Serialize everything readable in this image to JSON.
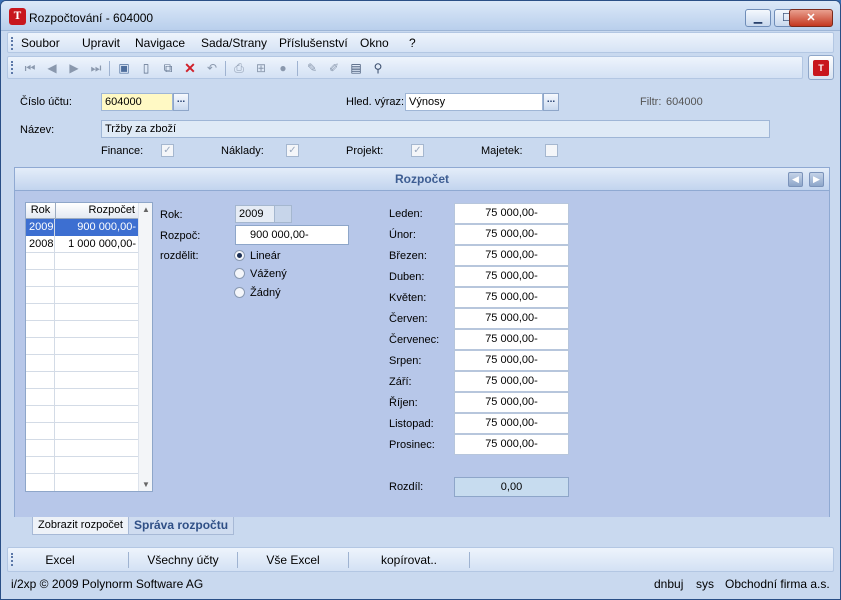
{
  "window": {
    "title": "Rozpočtování - 604000",
    "icon": "app-logo-icon",
    "minimize": "▁",
    "maximize": "☐",
    "close": "✕"
  },
  "menu": {
    "items": [
      "Soubor",
      "Upravit",
      "Navigace",
      "Sada/Strany",
      "Příslušenství",
      "Okno",
      "?"
    ]
  },
  "toolbar": {
    "icons": [
      "first-record-icon",
      "prev-record-icon",
      "next-record-icon",
      "last-record-icon",
      "save-icon",
      "new-document-icon",
      "copy-icon",
      "delete-icon",
      "undo-icon",
      "print-icon",
      "tree-icon",
      "refresh-icon",
      "edit-icon",
      "highlight-icon",
      "filter-icon",
      "wizard-icon"
    ]
  },
  "header": {
    "account_label": "Číslo účtu:",
    "account_value": "604000",
    "search_label": "Hled. výraz:",
    "search_value": "Výnosy",
    "filter_label": "Filtr:",
    "filter_value": "604000",
    "name_label": "Název:",
    "name_value": "Tržby za zboží",
    "dots": "...",
    "checkboxes": [
      {
        "label": "Finance:",
        "checked": true
      },
      {
        "label": "Náklady:",
        "checked": true
      },
      {
        "label": "Projekt:",
        "checked": true
      },
      {
        "label": "Majetek:",
        "checked": false
      }
    ],
    "check_mark": "✓"
  },
  "panel": {
    "title": "Rozpočet",
    "grid_headers": [
      "Rok",
      "Rozpočet"
    ],
    "grid_rows": [
      {
        "year": "2009",
        "budget": "900 000,00-",
        "selected": true
      },
      {
        "year": "2008",
        "budget": "1 000 000,00-",
        "selected": false
      }
    ],
    "year_label": "Rok:",
    "year_value": "2009",
    "budget_label": "Rozpoč:",
    "budget_value": "900 000,00-",
    "distribute_label": "rozdělit:",
    "radios": [
      {
        "label": "Lineár",
        "selected": true
      },
      {
        "label": "Vážený",
        "selected": false
      },
      {
        "label": "Žádný",
        "selected": false
      }
    ],
    "months": [
      {
        "name": "Leden:",
        "value": "75 000,00-"
      },
      {
        "name": "Únor:",
        "value": "75 000,00-"
      },
      {
        "name": "Březen:",
        "value": "75 000,00-"
      },
      {
        "name": "Duben:",
        "value": "75 000,00-"
      },
      {
        "name": "Květen:",
        "value": "75 000,00-"
      },
      {
        "name": "Červen:",
        "value": "75 000,00-"
      },
      {
        "name": "Červenec:",
        "value": "75 000,00-"
      },
      {
        "name": "Srpen:",
        "value": "75 000,00-"
      },
      {
        "name": "Září:",
        "value": "75 000,00-"
      },
      {
        "name": "Říjen:",
        "value": "75 000,00-"
      },
      {
        "name": "Listopad:",
        "value": "75 000,00-"
      },
      {
        "name": "Prosinec:",
        "value": "75 000,00-"
      }
    ],
    "difference_label": "Rozdíl:",
    "difference_value": "0,00"
  },
  "tabs": [
    "Zobrazit rozpočet",
    "Správa rozpočtu"
  ],
  "buttons": [
    "Excel",
    "Všechny účty",
    "Vše Excel",
    "kopírovat.."
  ],
  "status": {
    "copyright": "i/2xp © 2009 Polynorm Software AG",
    "db": "dnbuj",
    "user": "sys",
    "company": "Obchodní firma a.s."
  }
}
